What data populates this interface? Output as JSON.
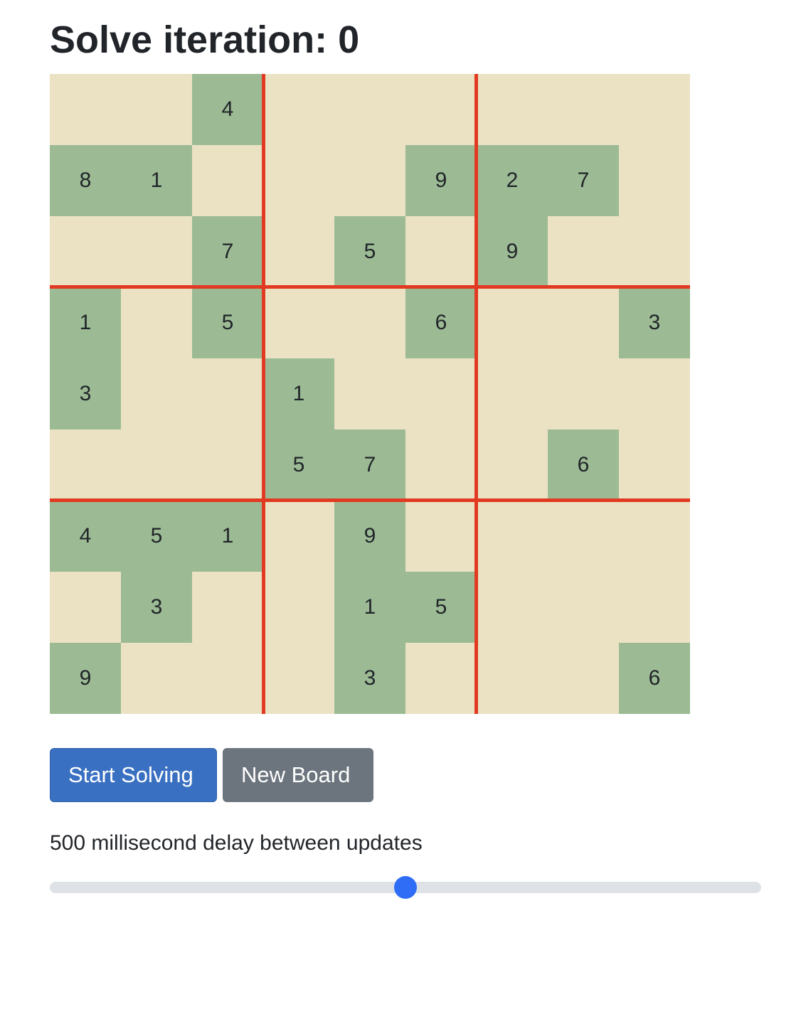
{
  "header": {
    "title_prefix": "Solve iteration: ",
    "iteration": "0"
  },
  "board": {
    "rows": [
      [
        "",
        "",
        "4",
        "",
        "",
        "",
        "",
        "",
        ""
      ],
      [
        "8",
        "1",
        "",
        "",
        "",
        "9",
        "2",
        "7",
        ""
      ],
      [
        "",
        "",
        "7",
        "",
        "5",
        "",
        "9",
        "",
        ""
      ],
      [
        "1",
        "",
        "5",
        "",
        "",
        "6",
        "",
        "",
        "3"
      ],
      [
        "3",
        "",
        "",
        "1",
        "",
        "",
        "",
        "",
        ""
      ],
      [
        "",
        "",
        "",
        "5",
        "7",
        "",
        "",
        "6",
        ""
      ],
      [
        "4",
        "5",
        "1",
        "",
        "9",
        "",
        "",
        "",
        ""
      ],
      [
        "",
        "3",
        "",
        "",
        "1",
        "5",
        "",
        "",
        ""
      ],
      [
        "9",
        "",
        "",
        "",
        "3",
        "",
        "",
        "",
        "6"
      ]
    ],
    "colors": {
      "given": "#9cbb95",
      "empty": "#ebe2c4",
      "box_line": "#e23a22"
    }
  },
  "controls": {
    "start_label": "Start Solving",
    "new_board_label": "New Board"
  },
  "delay": {
    "value": "500",
    "label_suffix": " millisecond delay between updates",
    "slider_fraction": 0.5
  }
}
